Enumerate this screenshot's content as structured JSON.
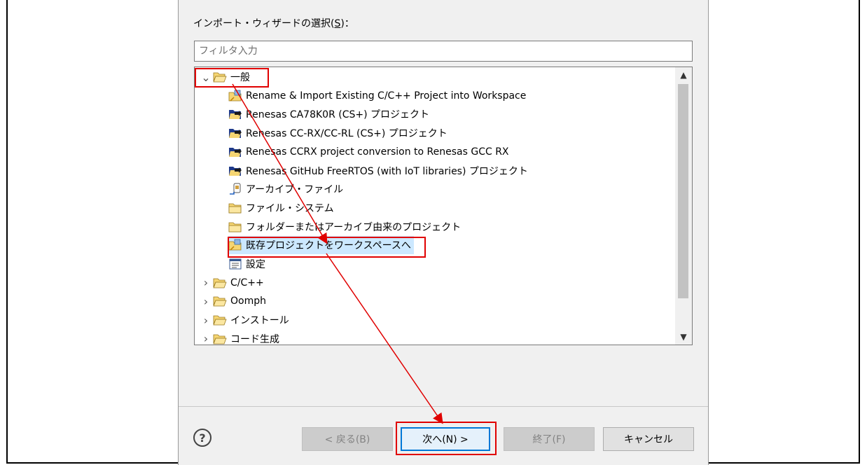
{
  "wizard": {
    "section_label_main": "インポート・ウィザードの選択(",
    "section_label_key": "S",
    "section_label_tail": ")：",
    "filter_placeholder": "フィルタ入力"
  },
  "tree": {
    "items": [
      {
        "label": "一般",
        "level": 0,
        "expanded": true,
        "icon": "folder-open-icon"
      },
      {
        "label": "Rename & Import Existing C/C++ Project into Workspace",
        "level": 1,
        "icon": "import-project-icon"
      },
      {
        "label": "Renesas CA78K0R (CS+) プロジェクト",
        "level": 1,
        "icon": "folder-arrow-icon"
      },
      {
        "label": "Renesas CC-RX/CC-RL (CS+) プロジェクト",
        "level": 1,
        "icon": "folder-arrow-icon"
      },
      {
        "label": "Renesas CCRX project conversion to Renesas GCC RX",
        "level": 1,
        "icon": "folder-arrow-icon"
      },
      {
        "label": "Renesas GitHub FreeRTOS (with IoT libraries) プロジェクト",
        "level": 1,
        "icon": "folder-arrow-icon"
      },
      {
        "label": "アーカイブ・ファイル",
        "level": 1,
        "icon": "archive-icon"
      },
      {
        "label": "ファイル・システム",
        "level": 1,
        "icon": "folder-icon"
      },
      {
        "label": "フォルダーまたはアーカイブ由来のプロジェクト",
        "level": 1,
        "icon": "folder-icon"
      },
      {
        "label": "既存プロジェクトをワークスペースへ",
        "level": 1,
        "icon": "import-project-icon",
        "selected": true
      },
      {
        "label": "設定",
        "level": 1,
        "icon": "preferences-icon"
      },
      {
        "label": "C/C++",
        "level": 0,
        "expanded": false,
        "icon": "folder-open-icon"
      },
      {
        "label": "Oomph",
        "level": 0,
        "expanded": false,
        "icon": "folder-open-icon"
      },
      {
        "label": "インストール",
        "level": 0,
        "expanded": false,
        "icon": "folder-open-icon"
      },
      {
        "label": "コード生成",
        "level": 0,
        "expanded": false,
        "icon": "folder-open-icon"
      }
    ]
  },
  "buttons": {
    "back": "< 戻る(B)",
    "next": "次へ(N) >",
    "finish": "終了(F)",
    "cancel": "キャンセル",
    "help": "?"
  },
  "colors": {
    "highlight_red": "#e00000",
    "primary_border": "#0078d7",
    "folder_yellow": "#f5d572",
    "folder_dark": "#1f3a8a"
  }
}
